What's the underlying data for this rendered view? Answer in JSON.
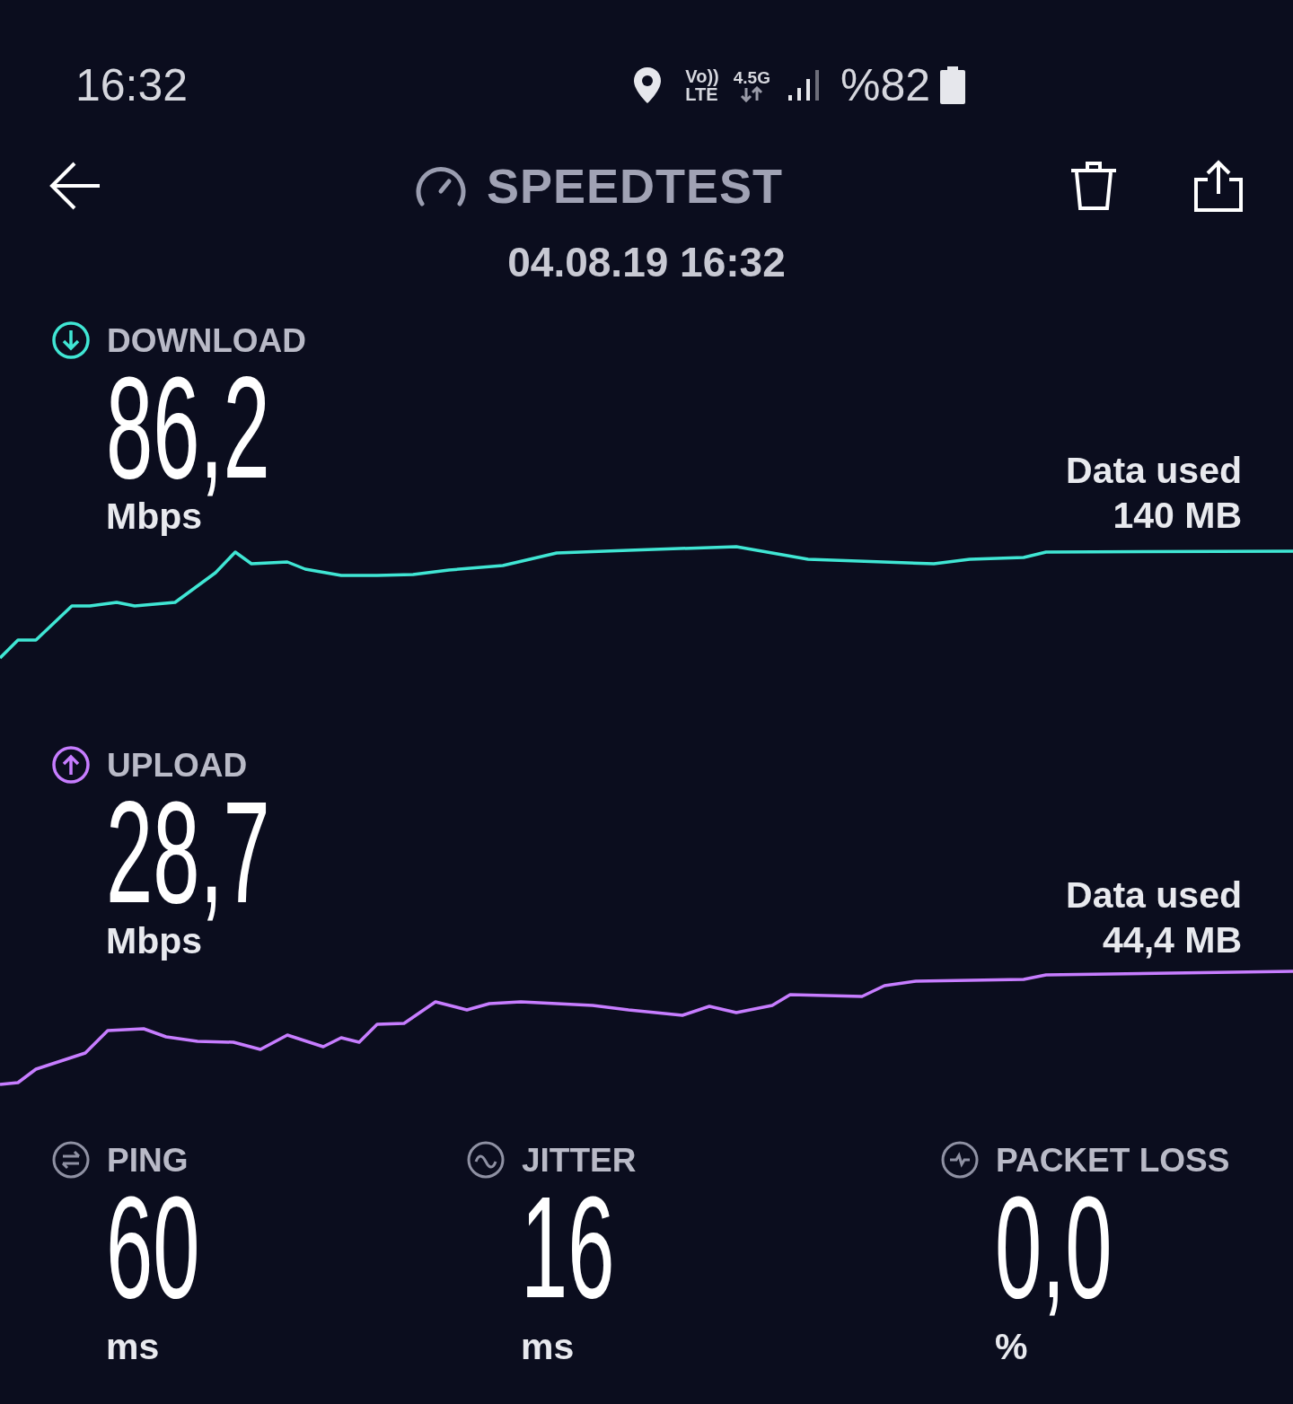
{
  "status_bar": {
    "time": "16:32",
    "volte_top": "Vo))",
    "volte_bottom": "LTE",
    "generation": "4.5G",
    "battery": "%82"
  },
  "header": {
    "title": "SPEEDTEST",
    "date": "04.08.19 16:32"
  },
  "results": [
    {
      "kind": "download",
      "label": "DOWNLOAD",
      "value": "86,2",
      "unit": "Mbps",
      "data_used_label": "Data used",
      "data_used": "140 MB",
      "color": "#40e6d4"
    },
    {
      "kind": "upload",
      "label": "UPLOAD",
      "value": "28,7",
      "unit": "Mbps",
      "data_used_label": "Data used",
      "data_used": "44,4 MB",
      "color": "#c77dff"
    }
  ],
  "metrics": [
    {
      "kind": "ping",
      "label": "PING",
      "value": "60",
      "unit": "ms"
    },
    {
      "kind": "jitter",
      "label": "JITTER",
      "value": "16",
      "unit": "ms"
    },
    {
      "kind": "packet_loss",
      "label": "PACKET LOSS",
      "value": "0,0",
      "unit": "%"
    }
  ]
}
